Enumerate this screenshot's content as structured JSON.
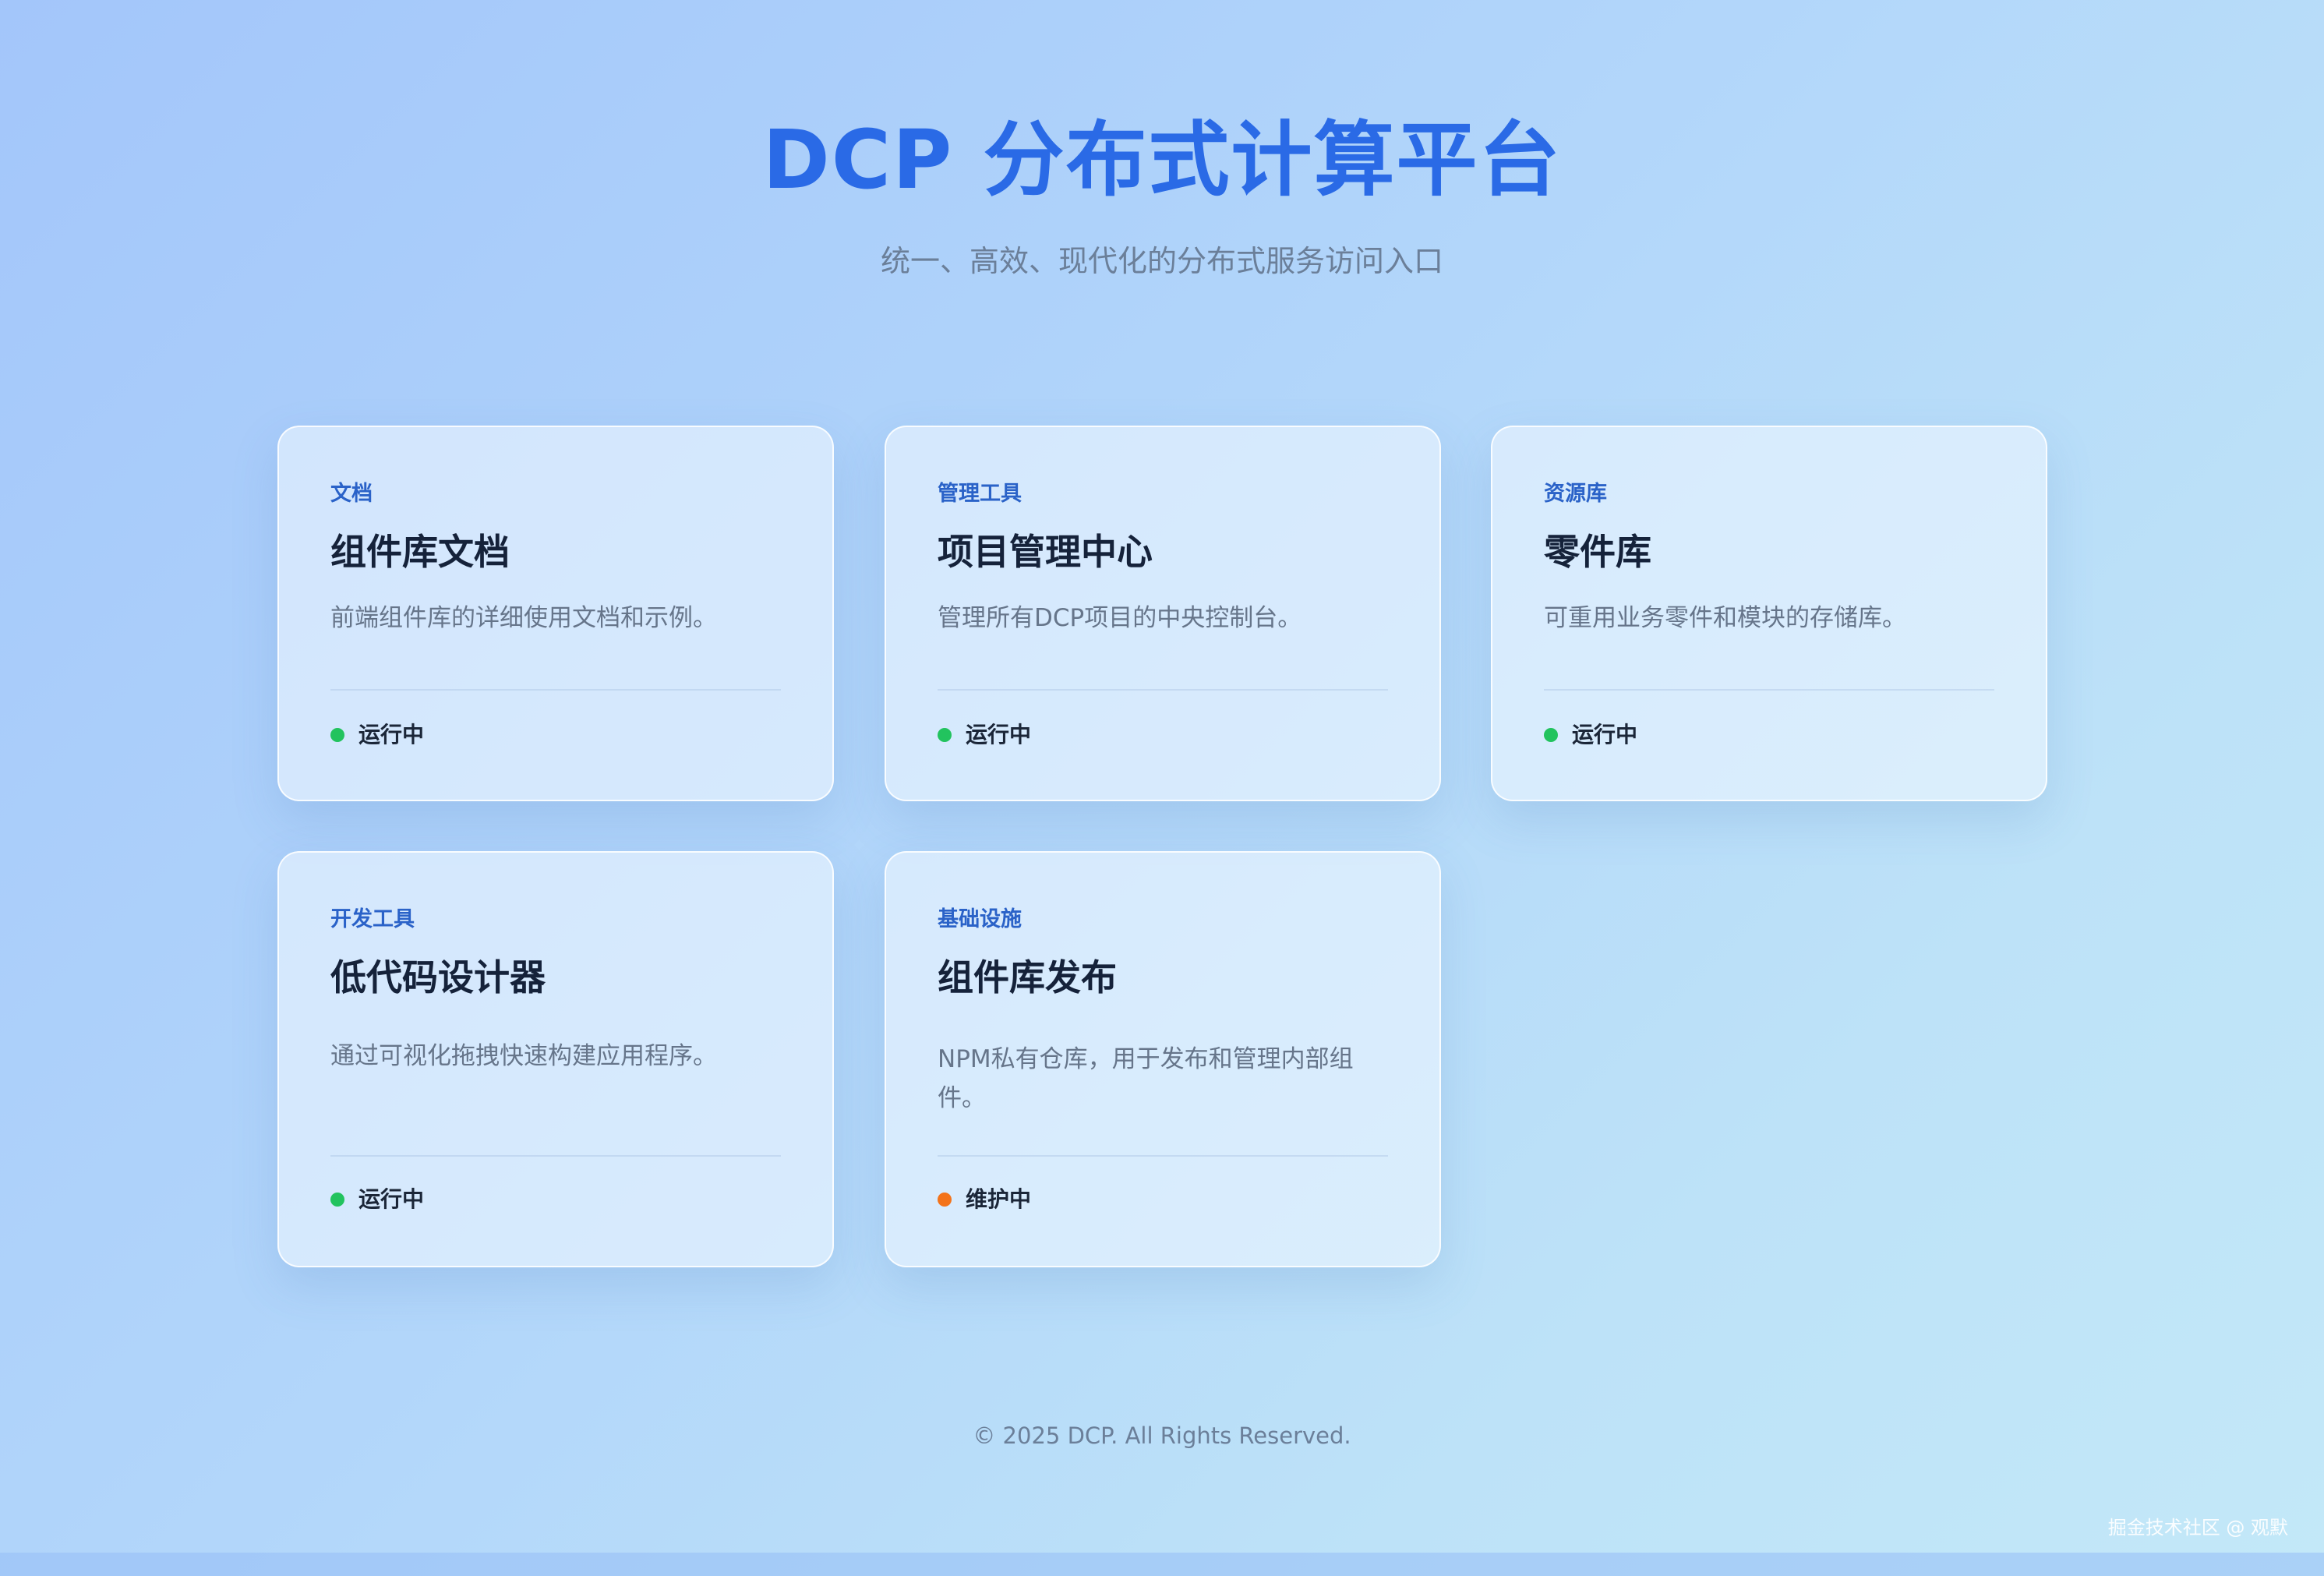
{
  "header": {
    "title": "DCP 分布式计算平台",
    "subtitle": "统一、高效、现代化的分布式服务访问入口"
  },
  "cards": [
    {
      "tag": "文档",
      "title": "组件库文档",
      "description": "前端组件库的详细使用文档和示例。",
      "status": {
        "label": "运行中",
        "color": "#22c35e"
      }
    },
    {
      "tag": "管理工具",
      "title": "项目管理中心",
      "description": "管理所有DCP项目的中央控制台。",
      "status": {
        "label": "运行中",
        "color": "#22c35e"
      }
    },
    {
      "tag": "资源库",
      "title": "零件库",
      "description": "可重用业务零件和模块的存储库。",
      "status": {
        "label": "运行中",
        "color": "#22c35e"
      }
    },
    {
      "tag": "开发工具",
      "title": "低代码设计器",
      "description": "通过可视化拖拽快速构建应用程序。",
      "status": {
        "label": "运行中",
        "color": "#22c35e"
      }
    },
    {
      "tag": "基础设施",
      "title": "组件库发布",
      "description": "NPM私有仓库，用于发布和管理内部组件。",
      "status": {
        "label": "维护中",
        "color": "#f3731a"
      }
    }
  ],
  "footer": {
    "copyright": "© 2025 DCP. All Rights Reserved."
  },
  "watermark": "掘金技术社区 @ 观默",
  "colors": {
    "accent": "#2a6ae6",
    "status_running": "#22c35e",
    "status_maintenance": "#f3731a"
  }
}
